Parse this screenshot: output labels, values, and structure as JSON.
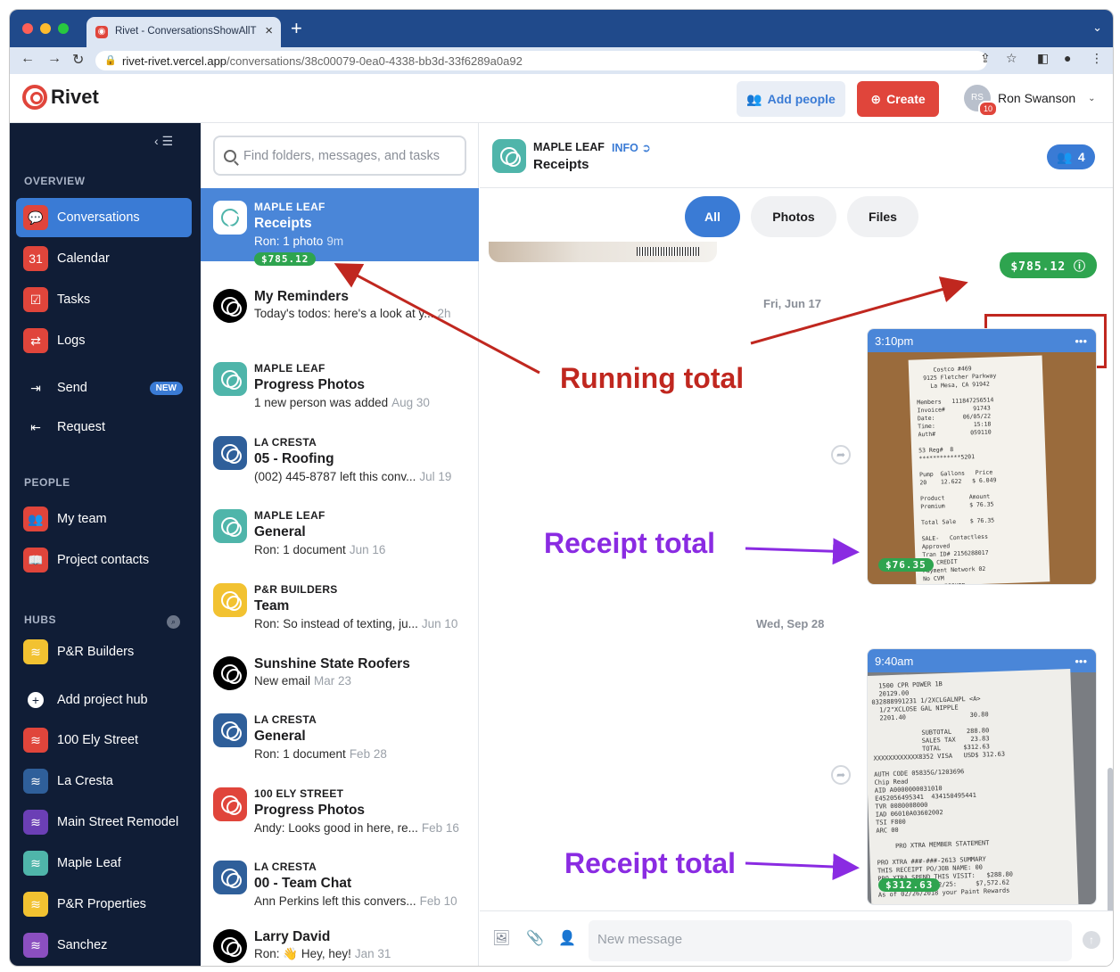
{
  "browser": {
    "tab_title": "Rivet - ConversationsShowAllT",
    "url_host": "rivet-rivet.vercel.app",
    "url_path": "/conversations/38c00079-0ea0-4338-bb3d-33f6289a0a92"
  },
  "header": {
    "logo": "Rivet",
    "add_people": "Add people",
    "create": "Create",
    "user_initials": "RS",
    "user_badge": "10",
    "user_name": "Ron Swanson"
  },
  "sidebar": {
    "overview_title": "OVERVIEW",
    "people_title": "PEOPLE",
    "hubs_title": "HUBS",
    "overview": [
      {
        "label": "Conversations",
        "icon": "chat-icon",
        "color": "#e0453b"
      },
      {
        "label": "Calendar",
        "icon": "calendar-icon",
        "color": "#e0453b"
      },
      {
        "label": "Tasks",
        "icon": "checkbox-icon",
        "color": "#e0453b"
      },
      {
        "label": "Logs",
        "icon": "swap-icon",
        "color": "#e0453b"
      },
      {
        "label": "Send",
        "icon": "send-icon",
        "badge": "NEW"
      },
      {
        "label": "Request",
        "icon": "request-icon"
      }
    ],
    "people": [
      {
        "label": "My team",
        "icon": "team-icon",
        "color": "#e0453b"
      },
      {
        "label": "Project contacts",
        "icon": "book-icon",
        "color": "#e0453b"
      }
    ],
    "hubs": [
      {
        "label": "P&R Builders",
        "color": "#f2c231"
      },
      {
        "label": "Add project hub",
        "icon": "plus-icon"
      },
      {
        "label": "100 Ely Street",
        "color": "#e0453b"
      },
      {
        "label": "La Cresta",
        "color": "#2f5f9a"
      },
      {
        "label": "Main Street Remodel",
        "color": "#6b3fb5"
      },
      {
        "label": "Maple Leaf",
        "color": "#4fb5aa"
      },
      {
        "label": "P&R Properties",
        "color": "#f2c231"
      },
      {
        "label": "Sanchez",
        "color": "#8b4fc0"
      }
    ]
  },
  "search": {
    "placeholder": "Find folders, messages, and tasks"
  },
  "conversations": [
    {
      "group": "MAPLE LEAF",
      "title": "Receipts",
      "preview": "Ron: 1 photo",
      "time": "9m",
      "total": "$785.12",
      "color": "#ffffff",
      "selected": true
    },
    {
      "group": "",
      "title": "My Reminders",
      "preview": "Today's todos: here's a look at y...",
      "time": "2h",
      "color": "#000000"
    },
    {
      "group": "MAPLE LEAF",
      "title": "Progress Photos",
      "preview": "1 new person was added",
      "time": "Aug 30",
      "color": "#4fb5aa"
    },
    {
      "group": "LA CRESTA",
      "title": "05 - Roofing",
      "preview": "(002) 445-8787 left this conv...",
      "time": "Jul 19",
      "color": "#2f5f9a"
    },
    {
      "group": "MAPLE LEAF",
      "title": "General",
      "preview": "Ron: 1 document",
      "time": "Jun 16",
      "color": "#4fb5aa"
    },
    {
      "group": "P&R BUILDERS",
      "title": "Team",
      "preview": "Ron: So instead of texting, ju...",
      "time": "Jun 10",
      "color": "#f2c231"
    },
    {
      "group": "",
      "title": "Sunshine State Roofers",
      "preview": "New email",
      "time": "Mar 23",
      "color": "#000000"
    },
    {
      "group": "LA CRESTA",
      "title": "General",
      "preview": "Ron: 1 document",
      "time": "Feb 28",
      "color": "#2f5f9a"
    },
    {
      "group": "100 ELY STREET",
      "title": "Progress Photos",
      "preview": "Andy: Looks good in here, re...",
      "time": "Feb 16",
      "color": "#e0453b"
    },
    {
      "group": "LA CRESTA",
      "title": "00 - Team Chat",
      "preview": "Ann Perkins left this convers...",
      "time": "Feb 10",
      "color": "#2f5f9a"
    },
    {
      "group": "",
      "title": "Larry David",
      "preview": "Ron: 👋 Hey, hey!",
      "time": "Jan 31",
      "color": "#000000"
    }
  ],
  "chat": {
    "group": "MAPLE LEAF",
    "info": "INFO",
    "title": "Receipts",
    "members": "4",
    "filters": [
      "All",
      "Photos",
      "Files"
    ],
    "running_total": "$785.12",
    "messages": [
      {
        "date": "Fri, Jun 17",
        "time": "3:10pm",
        "total": "$76.35"
      },
      {
        "date": "Wed, Sep 28",
        "time": "9:40am",
        "total": "$312.63"
      }
    ],
    "composer_placeholder": "New message"
  },
  "annotations": {
    "running": "Running total",
    "receipt1": "Receipt total",
    "receipt2": "Receipt total"
  }
}
